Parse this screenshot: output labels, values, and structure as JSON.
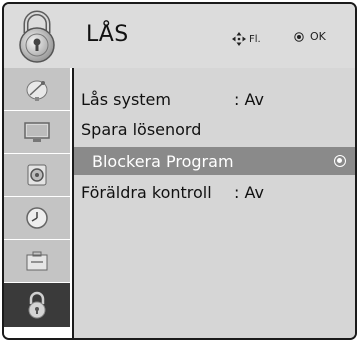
{
  "header": {
    "title": "LÅS",
    "move_label": "Fl.",
    "ok_label": "OK"
  },
  "sidebar": {
    "items": [
      {
        "icon": "satellite-dish-icon",
        "active": false
      },
      {
        "icon": "monitor-icon",
        "active": false
      },
      {
        "icon": "speaker-icon",
        "active": false
      },
      {
        "icon": "clock-icon",
        "active": false
      },
      {
        "icon": "toolbox-icon",
        "active": false
      },
      {
        "icon": "lock-icon",
        "active": true
      }
    ]
  },
  "menu": {
    "items": [
      {
        "label": "Lås system",
        "value": ": Av"
      },
      {
        "label": "Spara lösenord",
        "value": ""
      },
      {
        "label": "Blockera Program",
        "value": "",
        "selected": true
      },
      {
        "label": "Föräldra kontroll",
        "value": ": Av"
      }
    ]
  },
  "colors": {
    "header_bg": "#dcdcdc",
    "menu_bg": "#d6d6d6",
    "selected_bg": "#8a8a8a",
    "sidebar_inactive": "#c4c4c4",
    "sidebar_active": "#3a3a3a"
  }
}
